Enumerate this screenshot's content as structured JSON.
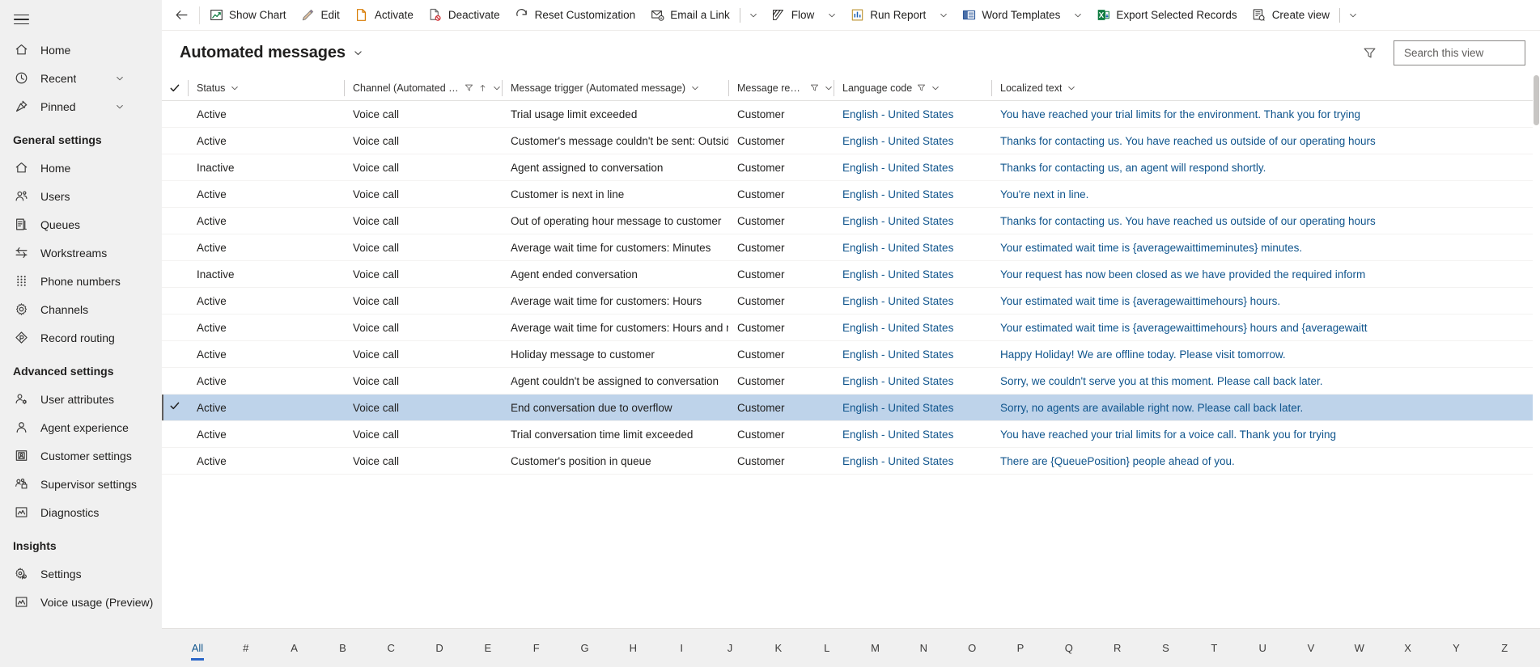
{
  "sidebar": {
    "hamburger": "site-map-toggle",
    "top_items": [
      {
        "icon": "home-icon",
        "label": "Home",
        "chevron": false
      },
      {
        "icon": "clock-icon",
        "label": "Recent",
        "chevron": true
      },
      {
        "icon": "pin-icon",
        "label": "Pinned",
        "chevron": true
      }
    ],
    "groups": [
      {
        "title": "General settings",
        "items": [
          {
            "icon": "home-icon",
            "label": "Home"
          },
          {
            "icon": "users-icon",
            "label": "Users"
          },
          {
            "icon": "queues-icon",
            "label": "Queues"
          },
          {
            "icon": "workstreams-icon",
            "label": "Workstreams"
          },
          {
            "icon": "phone-numbers-icon",
            "label": "Phone numbers"
          },
          {
            "icon": "gear-icon",
            "label": "Channels"
          },
          {
            "icon": "record-routing-icon",
            "label": "Record routing"
          }
        ]
      },
      {
        "title": "Advanced settings",
        "items": [
          {
            "icon": "user-attributes-icon",
            "label": "User attributes"
          },
          {
            "icon": "agent-experience-icon",
            "label": "Agent experience"
          },
          {
            "icon": "customer-settings-icon",
            "label": "Customer settings"
          },
          {
            "icon": "supervisor-settings-icon",
            "label": "Supervisor settings"
          },
          {
            "icon": "diagnostics-icon",
            "label": "Diagnostics"
          }
        ]
      },
      {
        "title": "Insights",
        "items": [
          {
            "icon": "insights-settings-icon",
            "label": "Settings"
          },
          {
            "icon": "voice-usage-icon",
            "label": "Voice usage (Preview)"
          }
        ]
      }
    ]
  },
  "commandbar": {
    "back": "back-arrow",
    "buttons": [
      {
        "label": "Show Chart",
        "icon": "chart-icon",
        "caret": false
      },
      {
        "label": "Edit",
        "icon": "pencil-icon",
        "caret": false
      },
      {
        "label": "Activate",
        "icon": "activate-icon",
        "caret": false
      },
      {
        "label": "Deactivate",
        "icon": "deactivate-icon",
        "caret": false
      },
      {
        "label": "Reset Customization",
        "icon": "reset-icon",
        "caret": false
      },
      {
        "label": "Email a Link",
        "icon": "email-link-icon",
        "caret": true,
        "divider": true
      },
      {
        "label": "Flow",
        "icon": "flow-icon",
        "caret": true
      },
      {
        "label": "Run Report",
        "icon": "run-report-icon",
        "caret": true
      },
      {
        "label": "Word Templates",
        "icon": "word-templates-icon",
        "caret": true
      },
      {
        "label": "Export Selected Records",
        "icon": "excel-export-icon",
        "caret": false
      },
      {
        "label": "Create view",
        "icon": "create-view-icon",
        "caret": true,
        "divider": true
      }
    ]
  },
  "view": {
    "title": "Automated messages",
    "title_caret": "chevron-down-icon",
    "filter_icon": "filter-icon",
    "search_placeholder": "Search this view",
    "search_value": "",
    "search_icon": "search-icon"
  },
  "grid": {
    "select_all_icon": "checkmark-icon",
    "columns": [
      {
        "key": "status",
        "label": "Status",
        "filter": false,
        "sort": false,
        "caret": true
      },
      {
        "key": "channel",
        "label": "Channel (Automated message)",
        "filter": true,
        "sort": true,
        "caret": true
      },
      {
        "key": "trigger",
        "label": "Message trigger (Automated message)",
        "filter": false,
        "sort": false,
        "caret": true
      },
      {
        "key": "recipient",
        "label": "Message recipient (...",
        "filter": true,
        "sort": false,
        "caret": true
      },
      {
        "key": "language",
        "label": "Language code",
        "filter": true,
        "sort": false,
        "caret": true
      },
      {
        "key": "text",
        "label": "Localized text",
        "filter": false,
        "sort": false,
        "caret": true
      }
    ],
    "rows": [
      {
        "selected": false,
        "status": "Active",
        "channel": "Voice call",
        "trigger": "Trial usage limit exceeded",
        "recipient": "Customer",
        "language": "English - United States",
        "text": "You have reached your trial limits for the environment. Thank you for trying"
      },
      {
        "selected": false,
        "status": "Active",
        "channel": "Voice call",
        "trigger": "Customer's message couldn't be sent: Outside ...",
        "recipient": "Customer",
        "language": "English - United States",
        "text": "Thanks for contacting us. You have reached us outside of our operating hours"
      },
      {
        "selected": false,
        "status": "Inactive",
        "channel": "Voice call",
        "trigger": "Agent assigned to conversation",
        "recipient": "Customer",
        "language": "English - United States",
        "text": "Thanks for contacting us, an agent will respond shortly."
      },
      {
        "selected": false,
        "status": "Active",
        "channel": "Voice call",
        "trigger": "Customer is next in line",
        "recipient": "Customer",
        "language": "English - United States",
        "text": "You're next in line."
      },
      {
        "selected": false,
        "status": "Active",
        "channel": "Voice call",
        "trigger": "Out of operating hour message to customer",
        "recipient": "Customer",
        "language": "English - United States",
        "text": "Thanks for contacting us. You have reached us outside of our operating hours"
      },
      {
        "selected": false,
        "status": "Active",
        "channel": "Voice call",
        "trigger": "Average wait time for customers: Minutes",
        "recipient": "Customer",
        "language": "English - United States",
        "text": "Your estimated wait time is {averagewaittimeminutes} minutes."
      },
      {
        "selected": false,
        "status": "Inactive",
        "channel": "Voice call",
        "trigger": "Agent ended conversation",
        "recipient": "Customer",
        "language": "English - United States",
        "text": "Your request has now been closed as we have provided the required inform"
      },
      {
        "selected": false,
        "status": "Active",
        "channel": "Voice call",
        "trigger": "Average wait time for customers: Hours",
        "recipient": "Customer",
        "language": "English - United States",
        "text": "Your estimated wait time is {averagewaittimehours} hours."
      },
      {
        "selected": false,
        "status": "Active",
        "channel": "Voice call",
        "trigger": "Average wait time for customers: Hours and mi...",
        "recipient": "Customer",
        "language": "English - United States",
        "text": "Your estimated wait time is {averagewaittimehours} hours and {averagewaitt"
      },
      {
        "selected": false,
        "status": "Active",
        "channel": "Voice call",
        "trigger": "Holiday message to customer",
        "recipient": "Customer",
        "language": "English - United States",
        "text": "Happy Holiday! We are offline today. Please visit tomorrow."
      },
      {
        "selected": false,
        "status": "Active",
        "channel": "Voice call",
        "trigger": "Agent couldn't be assigned to conversation",
        "recipient": "Customer",
        "language": "English - United States",
        "text": "Sorry, we couldn't serve you at this moment. Please call back later."
      },
      {
        "selected": true,
        "status": "Active",
        "channel": "Voice call",
        "trigger": "End conversation due to overflow",
        "recipient": "Customer",
        "language": "English - United States",
        "text": "Sorry, no agents are available right now. Please call back later."
      },
      {
        "selected": false,
        "status": "Active",
        "channel": "Voice call",
        "trigger": "Trial conversation time limit exceeded",
        "recipient": "Customer",
        "language": "English - United States",
        "text": "You have reached your trial limits for a voice call. Thank you for trying"
      },
      {
        "selected": false,
        "status": "Active",
        "channel": "Voice call",
        "trigger": "Customer's position in queue",
        "recipient": "Customer",
        "language": "English - United States",
        "text": "There are {QueuePosition} people ahead of you."
      }
    ]
  },
  "alphabet": {
    "active": "All",
    "items": [
      "All",
      "#",
      "A",
      "B",
      "C",
      "D",
      "E",
      "F",
      "G",
      "H",
      "I",
      "J",
      "K",
      "L",
      "M",
      "N",
      "O",
      "P",
      "Q",
      "R",
      "S",
      "T",
      "U",
      "V",
      "W",
      "X",
      "Y",
      "Z"
    ]
  },
  "colors": {
    "accent": "#2a66c8",
    "link": "#0f548c",
    "selected_row": "#bed3ea",
    "sidebar_bg": "#f0f0f0"
  }
}
